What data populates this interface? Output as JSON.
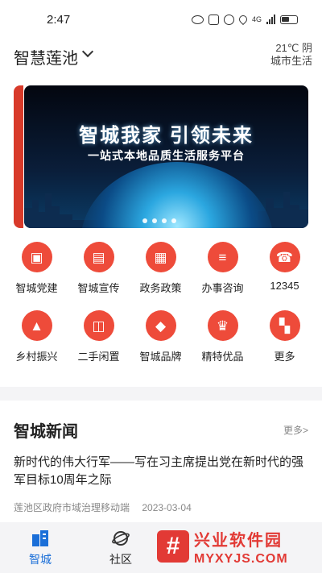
{
  "status_bar": {
    "time": "2:47",
    "network": "4G"
  },
  "header": {
    "city": "智慧莲池",
    "weather": "21℃ 阴",
    "weather_sub": "城市生活"
  },
  "banner": {
    "title": "智城我家  引领未来",
    "subtitle": "一站式本地品质生活服务平台",
    "dots": 4,
    "active_dot": 1
  },
  "menu": {
    "items": [
      {
        "label": "智城党建",
        "icon": "party-building-icon",
        "glyph": "▣"
      },
      {
        "label": "智城宣传",
        "icon": "publicity-icon",
        "glyph": "▤"
      },
      {
        "label": "政务政策",
        "icon": "policy-icon",
        "glyph": "▦"
      },
      {
        "label": "办事咨询",
        "icon": "consult-chat-icon",
        "glyph": "≡"
      },
      {
        "label": "12345",
        "icon": "phone-icon",
        "glyph": "☎"
      },
      {
        "label": "乡村振兴",
        "icon": "mountain-icon",
        "glyph": "▲"
      },
      {
        "label": "二手闲置",
        "icon": "backpack-icon",
        "glyph": "◫"
      },
      {
        "label": "智城品牌",
        "icon": "diamond-icon",
        "glyph": "◆"
      },
      {
        "label": "精特优品",
        "icon": "crown-icon",
        "glyph": "♛"
      },
      {
        "label": "更多",
        "icon": "grid-more-icon",
        "glyph": "▚"
      }
    ]
  },
  "news": {
    "title": "智城新闻",
    "more": "更多>",
    "items": [
      {
        "headline": "新时代的伟大行军——写在习主席提出党在新时代的强军目标10周年之际",
        "source": "莲池区政府市域治理移动端",
        "date": "2023-03-04"
      }
    ]
  },
  "tabbar": {
    "tabs": [
      {
        "label": "智城",
        "icon": "home-icon",
        "active": true
      },
      {
        "label": "社区",
        "icon": "planet-icon",
        "active": false
      }
    ]
  },
  "watermark": {
    "mark": "#",
    "cn": "兴业软件园",
    "en": "MYXYJS.COM"
  },
  "colors": {
    "accent_red": "#ee4b3a",
    "tab_active": "#1b6fd8"
  }
}
